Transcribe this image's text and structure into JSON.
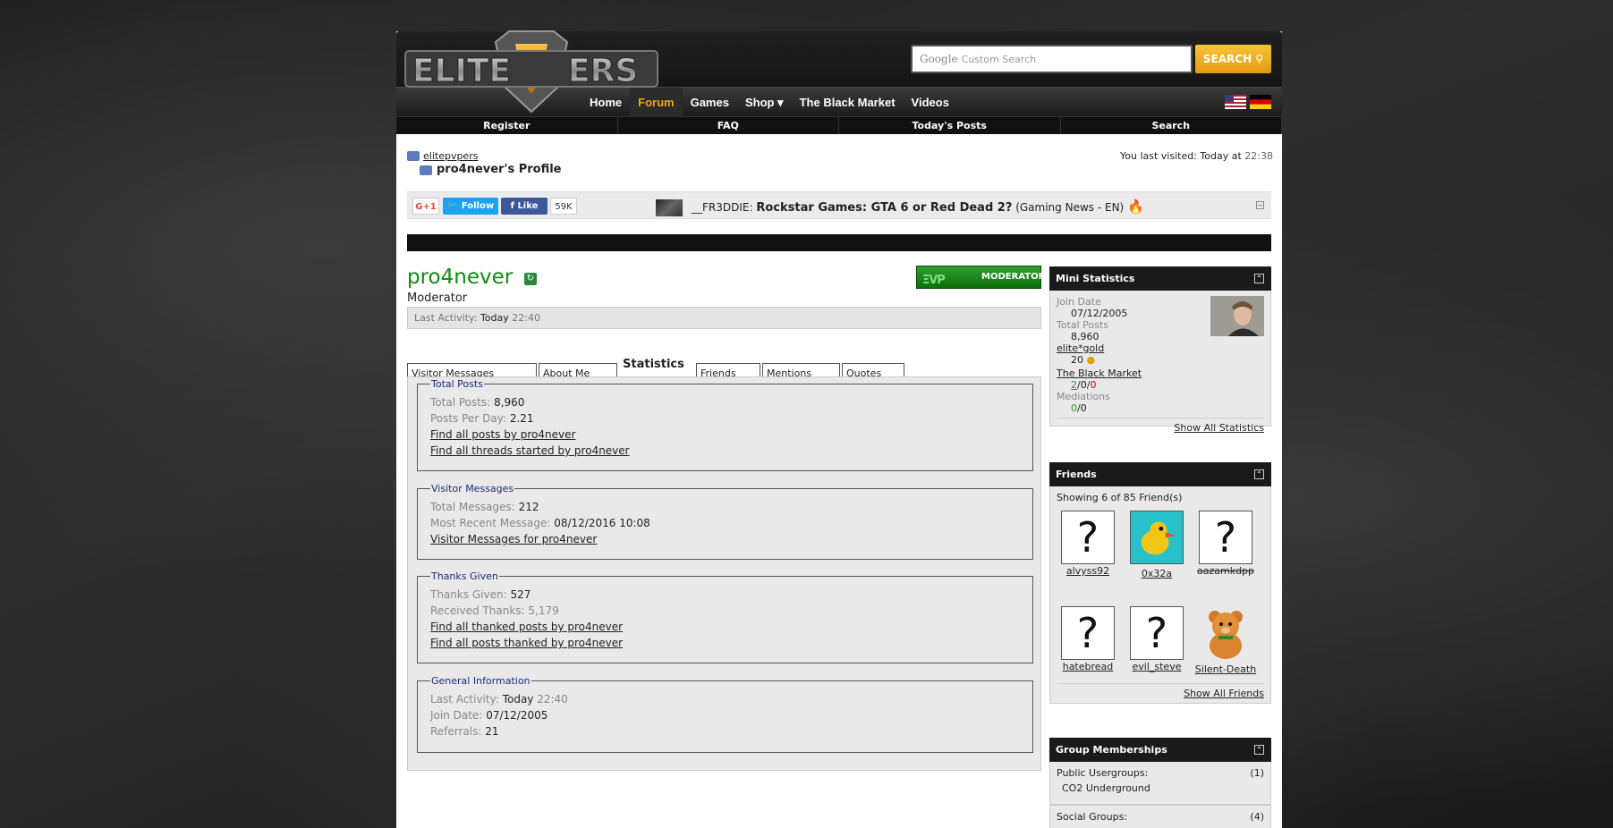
{
  "site": {
    "logo_text": "ELITEPVPERS",
    "search": {
      "placeholder": "Custom Search",
      "google_label": "Google",
      "button_label": "SEARCH"
    },
    "nav": [
      "Home",
      "Forum",
      "Games",
      "Shop ▾",
      "The Black Market",
      "Videos"
    ],
    "nav_active": "Forum",
    "subnav": [
      "Register",
      "FAQ",
      "Today's Posts",
      "Search"
    ]
  },
  "breadcrumb": {
    "root": "elitepvpers",
    "current": "pro4never's Profile"
  },
  "last_visit": {
    "label": "You last visited:",
    "day": "Today at",
    "time": "22:38"
  },
  "social": {
    "gplus": "G+1",
    "twitter": "Follow",
    "facebook": "Like",
    "like_count": "59K",
    "news_user": "__FR3DDIE:",
    "news_title": "Rockstar Games: GTA 6 or Red Dead 2?",
    "news_section": "(Gaming News - EN)"
  },
  "profile": {
    "username": "pro4never",
    "role": "Moderator",
    "badge": "MODERATOR",
    "last_activity": {
      "label": "Last Activity:",
      "day": "Today",
      "time": "22:40"
    }
  },
  "tabs": [
    "Visitor Messages",
    "About Me",
    "Statistics",
    "Friends",
    "Mentions",
    "Quotes"
  ],
  "tab_selected": "Statistics",
  "stats": {
    "total_posts": {
      "legend": "Total Posts",
      "total_label": "Total Posts:",
      "total_value": "8,960",
      "ppd_label": "Posts Per Day:",
      "ppd_value": "2.21",
      "link1": "Find all posts by pro4never",
      "link2": "Find all threads started by pro4never"
    },
    "visitor_messages": {
      "legend": "Visitor Messages",
      "total_label": "Total Messages:",
      "total_value": "212",
      "recent_label": "Most Recent Message:",
      "recent_value": "08/12/2016 10:08",
      "link": "Visitor Messages for pro4never"
    },
    "thanks": {
      "legend": "Thanks Given",
      "given_label": "Thanks Given:",
      "given_value": "527",
      "received": "Received Thanks: 5,179",
      "link1": "Find all thanked posts by pro4never",
      "link2": "Find all posts thanked by pro4never"
    },
    "general": {
      "legend": "General Information",
      "activity_label": "Last Activity:",
      "activity_day": "Today",
      "activity_time": "22:40",
      "join_label": "Join Date:",
      "join_value": "07/12/2005",
      "ref_label": "Referrals:",
      "ref_value": "21"
    }
  },
  "mini_stats": {
    "title": "Mini Statistics",
    "join_label": "Join Date",
    "join_value": "07/12/2005",
    "posts_label": "Total Posts",
    "posts_value": "8,960",
    "gold_label": "elite*gold",
    "gold_value": "20",
    "market_label": "The Black Market",
    "market_pos": "2",
    "market_neu": "0",
    "market_neg": "0",
    "med_label": "Mediations",
    "med_pos": "0",
    "med_neg": "0",
    "show_all": "Show All Statistics"
  },
  "friends": {
    "title": "Friends",
    "showing": "Showing 6 of 85 Friend(s)",
    "list": [
      "alvyss92",
      "0x32a",
      "aazamkdpp",
      "hatebread",
      "evil_steve",
      "Silent-Death"
    ],
    "show_all": "Show All Friends"
  },
  "groups": {
    "title": "Group Memberships",
    "public_label": "Public Usergroups:",
    "public_count": "(1)",
    "public_item": "CO2 Underground",
    "social_label": "Social Groups:",
    "social_count": "(4)"
  },
  "colors": {
    "accent": "#f1a21a",
    "username": "#118b11",
    "header": "#1a1a1a"
  }
}
